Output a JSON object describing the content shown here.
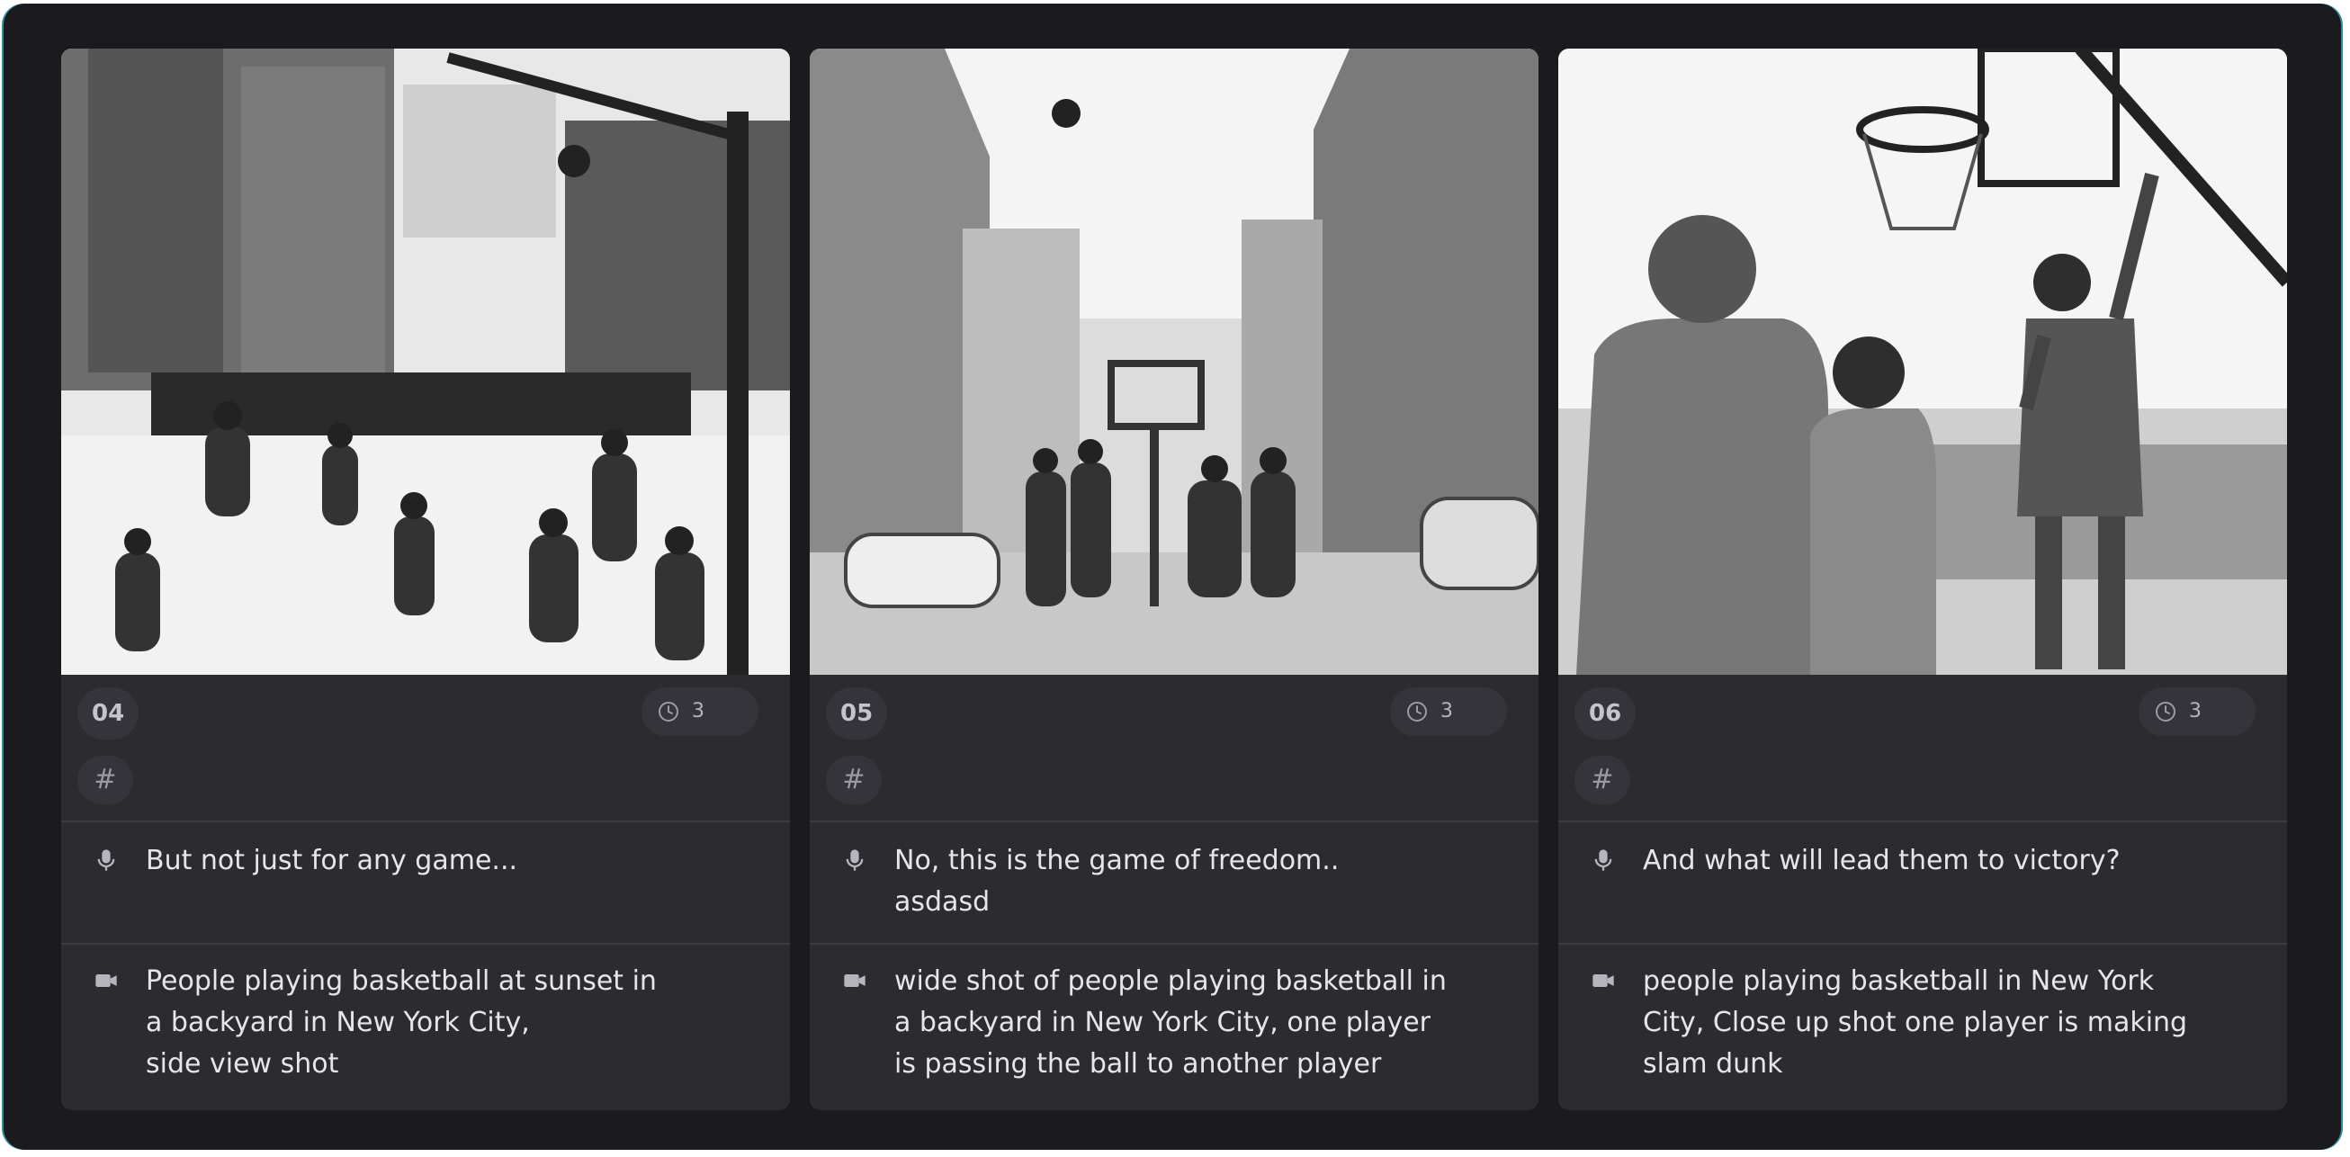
{
  "cards": [
    {
      "number": "04",
      "duration": "3",
      "tag_symbol": "#",
      "narration": "But not just for any game...",
      "video_prompt": "People playing basketball at sunset in\na backyard in New York City,\nside view shot",
      "image_subject": "sketch of people playing basketball between city buildings"
    },
    {
      "number": "05",
      "duration": "3",
      "tag_symbol": "#",
      "narration": "No, this is the game of freedom..\nasdasd",
      "video_prompt": "wide shot of people playing basketball in\na backyard in New York City, one player\nis  passing the ball to another player",
      "image_subject": "sketch of street basketball in a narrow alley with cars"
    },
    {
      "number": "06",
      "duration": "3",
      "tag_symbol": "#",
      "narration": "And what will lead them to victory?",
      "video_prompt": "people playing basketball in New York\nCity, Close up shot one player is making\nslam dunk",
      "image_subject": "close up sketch of a player jumping to the hoop"
    }
  ],
  "icons": {
    "duration": "clock-icon",
    "narration": "microphone-icon",
    "video_prompt": "video-camera-icon",
    "tag": "hash-icon"
  },
  "colors": {
    "frame_background": "#1b1b1f",
    "card_background": "#2b2b30",
    "badge_background": "#34343a",
    "text_primary": "#e6e6ea",
    "text_muted": "#b5b5bd",
    "accent_edge": "#2e8ea0"
  }
}
